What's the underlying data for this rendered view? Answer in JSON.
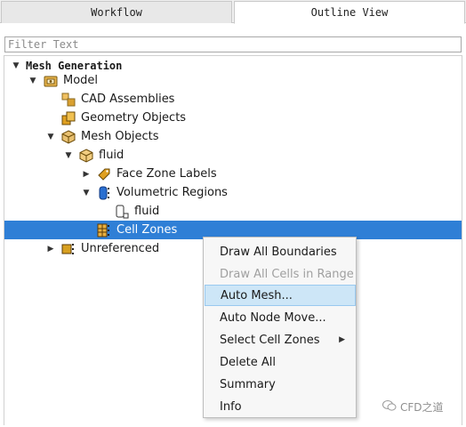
{
  "tabs": [
    {
      "label": "Workflow",
      "active": false
    },
    {
      "label": "Outline View",
      "active": true
    }
  ],
  "filter": {
    "placeholder": "Filter Text",
    "value": ""
  },
  "tree": {
    "root": "Mesh Generation",
    "model": "Model",
    "cad_assemblies": "CAD Assemblies",
    "geometry_objects": "Geometry Objects",
    "mesh_objects": "Mesh Objects",
    "fluid": "fluid",
    "face_zone_labels": "Face Zone Labels",
    "volumetric_regions": "Volumetric Regions",
    "fluid_region": "fluid",
    "cell_zones": "Cell Zones",
    "unreferenced": "Unreferenced"
  },
  "context_menu": {
    "items": [
      {
        "label": "Draw All Boundaries",
        "enabled": true
      },
      {
        "label": "Draw All Cells in Range",
        "enabled": false
      },
      {
        "label": "Auto Mesh...",
        "enabled": true,
        "highlighted": true
      },
      {
        "label": "Auto Node Move...",
        "enabled": true
      },
      {
        "label": "Select Cell Zones",
        "enabled": true,
        "submenu": true
      },
      {
        "label": "Delete All",
        "enabled": true
      },
      {
        "label": "Summary",
        "enabled": true
      },
      {
        "label": "Info",
        "enabled": true
      }
    ]
  },
  "watermark": "CFD之道",
  "colors": {
    "selection": "#2f7fd6",
    "menu_hover": "#cde6f7"
  }
}
